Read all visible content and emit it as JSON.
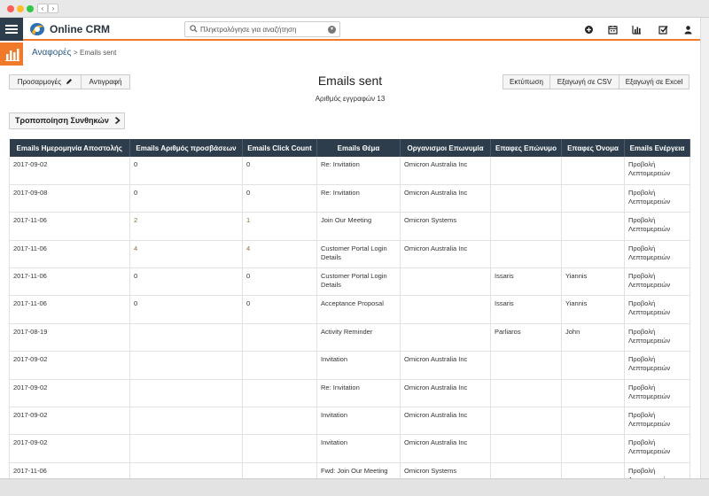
{
  "header": {
    "brand": "Online CRM",
    "search_placeholder": "Πληκτρολόγησε για αναζήτηση"
  },
  "breadcrumb": {
    "root": "Αναφορές",
    "separator": ">",
    "current": "Emails sent"
  },
  "report": {
    "title": "Emails sent",
    "record_count": "Αριθμός εγγραφών 13"
  },
  "toolbar": {
    "customize": "Προσαρμογές",
    "copy": "Αντιγραφή",
    "print": "Εκτύπωση",
    "export_csv": "Εξαγωγή σε CSV",
    "export_excel": "Εξαγωγή σε Excel",
    "edit_conditions": "Τροποποίηση Συνθηκών"
  },
  "table": {
    "columns": [
      "Emails Ημερομηνία Αποστολής",
      "Emails Αριθμός προσβάσεων",
      "Emails Click Count",
      "Emails Θέμα",
      "Οργανισμοι Επωνυμία",
      "Επαφες Επώνυμο",
      "Επαφες Όνομα",
      "Emails Ενέργεια"
    ],
    "rows": [
      [
        "2017-09-02",
        "0",
        "0",
        "Re: Invitation",
        "Omicron Australia Inc",
        "",
        "",
        "Προβολή Λεπτομερειών"
      ],
      [
        "2017-09-08",
        "0",
        "0",
        "Re: Invitation",
        "Omicron Australia Inc",
        "",
        "",
        "Προβολή Λεπτομερειών"
      ],
      [
        "2017-11-06",
        "2",
        "1",
        "Join Our Meeting",
        "Omicron Systems",
        "",
        "",
        "Προβολή Λεπτομερειών"
      ],
      [
        "2017-11-06",
        "4",
        "4",
        "Customer Portal Login Details",
        "Omicron Australia Inc",
        "",
        "",
        "Προβολή Λεπτομερειών"
      ],
      [
        "2017-11-06",
        "0",
        "0",
        "Customer Portal Login Details",
        "",
        "Issaris",
        "Yiannis",
        "Προβολή Λεπτομερειών"
      ],
      [
        "2017-11-06",
        "0",
        "0",
        "Acceptance Proposal",
        "",
        "Issaris",
        "Yiannis",
        "Προβολή Λεπτομερειών"
      ],
      [
        "2017-08-19",
        "",
        "",
        "Activity Reminder",
        "",
        "Parliaros",
        "John",
        "Προβολή Λεπτομερειών"
      ],
      [
        "2017-09-02",
        "",
        "",
        "Invitation",
        "Omicron Australia Inc",
        "",
        "",
        "Προβολή Λεπτομερειών"
      ],
      [
        "2017-09-02",
        "",
        "",
        "Re: Invitation",
        "Omicron Australia Inc",
        "",
        "",
        "Προβολή Λεπτομερειών"
      ],
      [
        "2017-09-02",
        "",
        "",
        "Invitation",
        "Omicron Australia Inc",
        "",
        "",
        "Προβολή Λεπτομερειών"
      ],
      [
        "2017-09-02",
        "",
        "",
        "Invitation",
        "Omicron Australia Inc",
        "",
        "",
        "Προβολή Λεπτομερειών"
      ],
      [
        "2017-11-06",
        "",
        "",
        "Fwd: Join Our Meeting",
        "Omicron Systems",
        "",
        "",
        "Προβολή Λεπτομερειών"
      ]
    ]
  },
  "colors": {
    "dark": "#2e3d4c",
    "accent": "#f07a2a",
    "link": "#2a5a84"
  },
  "icons": [
    "menu-icon",
    "search-icon",
    "chevron-down-icon",
    "plus-circle-icon",
    "calendar-icon",
    "bar-chart-icon",
    "checkbox-icon",
    "user-icon",
    "pencil-icon",
    "chevron-right-icon",
    "reports-chart-icon"
  ]
}
